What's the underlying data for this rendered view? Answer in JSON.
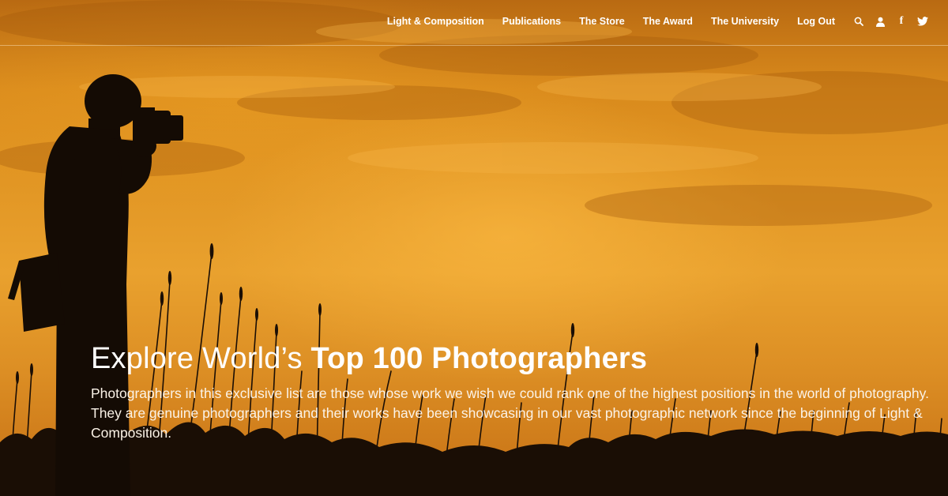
{
  "nav": {
    "items": [
      {
        "label": "Light & Composition"
      },
      {
        "label": "Publications"
      },
      {
        "label": "The Store"
      },
      {
        "label": "The Award"
      },
      {
        "label": "The University"
      },
      {
        "label": "Log Out"
      }
    ],
    "icons": [
      "search-icon",
      "user-icon",
      "facebook-icon",
      "twitter-icon"
    ],
    "facebook_glyph": "f"
  },
  "hero": {
    "headline_light": "Explore World’s ",
    "headline_bold": "Top 100 Photographers",
    "description": "Photographers in this exclusive list are those whose work we wish we could rank one of the highest positions in the world of photography. They are genuine photographers and their works have been showcasing in our vast photographic network since the beginning of Light & Composition."
  },
  "colors": {
    "sky_top": "#b96a12",
    "sky_mid": "#e9a12e",
    "silhouette": "#140b04",
    "text": "#ffffff"
  }
}
